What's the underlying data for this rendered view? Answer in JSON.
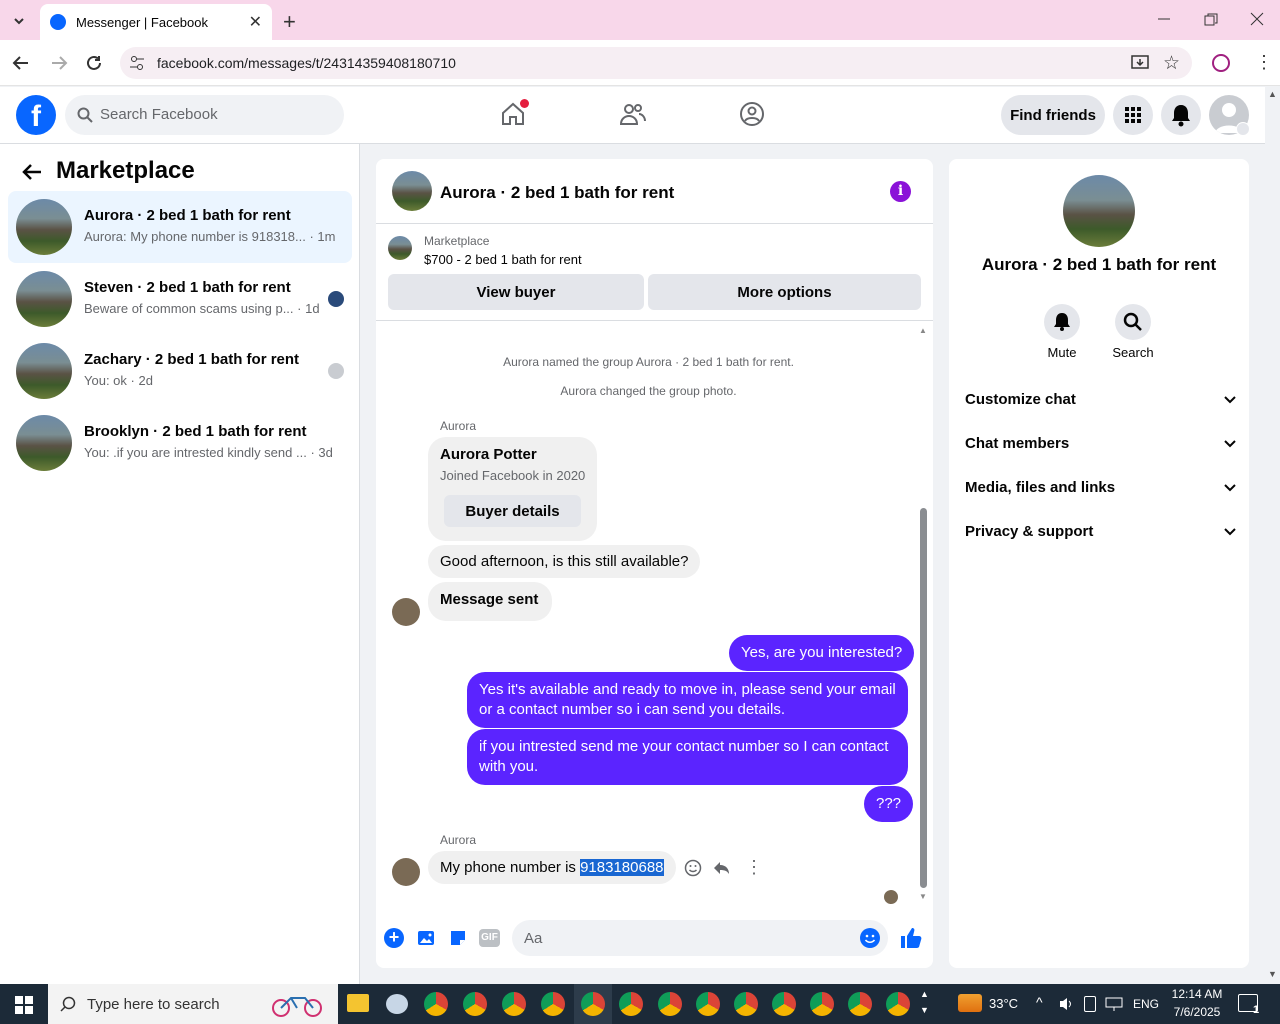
{
  "browser": {
    "tab_title": "Messenger | Facebook",
    "url": "facebook.com/messages/t/24314359408180710"
  },
  "fb_header": {
    "search_placeholder": "Search Facebook",
    "find_friends_label": "Find friends"
  },
  "sidebar": {
    "title": "Marketplace",
    "conversations": [
      {
        "title": "Aurora · 2 bed 1 bath for rent",
        "preview": "Aurora: My phone number is 918318...",
        "time": "· 1m"
      },
      {
        "title": "Steven · 2 bed 1 bath for rent",
        "preview": "Beware of common scams using p...",
        "time": "· 1d"
      },
      {
        "title": "Zachary · 2 bed 1 bath for rent",
        "preview": "You: ok",
        "time": "· 2d"
      },
      {
        "title": "Brooklyn · 2 bed 1 bath for rent",
        "preview": "You: .if you are intrested kindly send ...",
        "time": "· 3d"
      }
    ]
  },
  "chat": {
    "title": "Aurora · 2 bed 1 bath for rent",
    "listing_source": "Marketplace",
    "listing_title": "$700 - 2 bed 1 bath for rent",
    "view_buyer_label": "View buyer",
    "more_options_label": "More options",
    "system_messages": [
      "Aurora named the group Aurora · 2 bed 1 bath for rent.",
      "Aurora changed the group photo."
    ],
    "sender_name": "Aurora",
    "buyer_card": {
      "name": "Aurora Potter",
      "joined": "Joined Facebook in 2020",
      "button_label": "Buyer details"
    },
    "incoming_1": "Good afternoon, is this still available?",
    "incoming_2": "Message sent",
    "outgoing": [
      "Yes, are you interested?",
      "Yes it's available and ready to move in, please send your email or a contact number so i can send you details.",
      "if you intrested send me your contact number so I can contact with you.",
      "???"
    ],
    "last_sender_name": "Aurora",
    "last_message_prefix": "My phone number is ",
    "last_message_selected": "9183180688",
    "composer_placeholder": "Aa",
    "gif_label": "GIF"
  },
  "info_panel": {
    "title": "Aurora · 2 bed 1 bath for rent",
    "mute_label": "Mute",
    "search_label": "Search",
    "sections": [
      "Customize chat",
      "Chat members",
      "Media, files and links",
      "Privacy & support"
    ]
  },
  "taskbar": {
    "search_placeholder": "Type here to search",
    "temperature": "33°C",
    "language": "ENG",
    "time": "12:14 AM",
    "date": "7/6/2025",
    "notification_count": "1"
  },
  "colors": {
    "fb_blue": "#0866ff",
    "outgoing_bubble": "#5b24ff",
    "info_purple": "#8a12d8"
  }
}
